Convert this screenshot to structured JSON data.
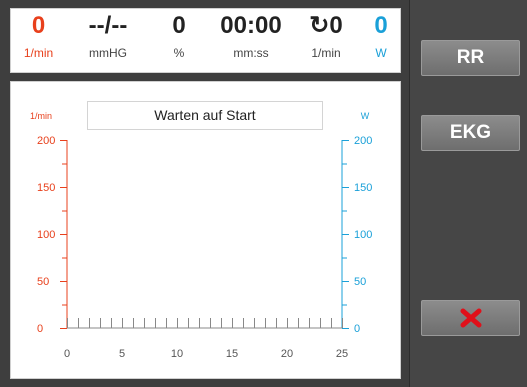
{
  "stats": [
    {
      "value": "0",
      "unit": "1/min",
      "color": "red"
    },
    {
      "value": "--/--",
      "unit": "mmHG",
      "color": "dark"
    },
    {
      "value": "0",
      "unit": "%",
      "color": "dark"
    },
    {
      "value": "00:00",
      "unit": "mm:ss",
      "color": "dark"
    },
    {
      "value": "↻0",
      "unit": "1/min",
      "color": "dark"
    },
    {
      "value": "0",
      "unit": "W",
      "color": "blue"
    }
  ],
  "status_text": "Warten auf Start",
  "buttons": {
    "rr_label": "RR",
    "ekg_label": "EKG",
    "cancel_icon": "red-x-icon"
  },
  "colors": {
    "heart_rate": "#e8401c",
    "power": "#1aa0d8",
    "cancel": "#e0101a"
  },
  "chart_data": {
    "type": "line",
    "x_ticks": [
      "0",
      "5",
      "10",
      "15",
      "20",
      "25"
    ],
    "xlim": [
      0,
      25
    ],
    "y_left": {
      "label": "1/min",
      "ticks": [
        "0",
        "50",
        "100",
        "150",
        "200"
      ],
      "lim": [
        0,
        200
      ]
    },
    "y_right": {
      "label": "W",
      "ticks": [
        "0",
        "50",
        "100",
        "150",
        "200"
      ],
      "lim": [
        0,
        200
      ]
    },
    "series": []
  }
}
